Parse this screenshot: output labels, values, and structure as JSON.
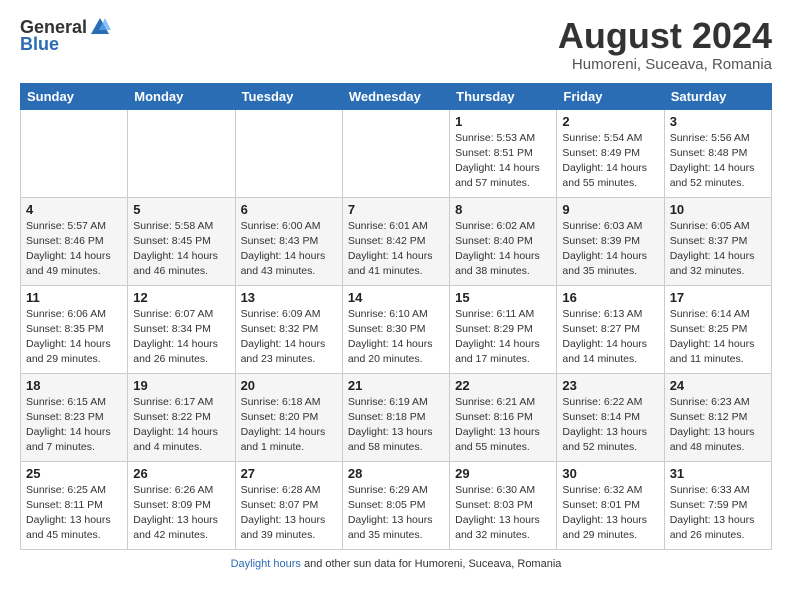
{
  "header": {
    "logo_general": "General",
    "logo_blue": "Blue",
    "month_title": "August 2024",
    "subtitle": "Humoreni, Suceava, Romania"
  },
  "weekdays": [
    "Sunday",
    "Monday",
    "Tuesday",
    "Wednesday",
    "Thursday",
    "Friday",
    "Saturday"
  ],
  "weeks": [
    [
      {
        "day": "",
        "info": ""
      },
      {
        "day": "",
        "info": ""
      },
      {
        "day": "",
        "info": ""
      },
      {
        "day": "",
        "info": ""
      },
      {
        "day": "1",
        "info": "Sunrise: 5:53 AM\nSunset: 8:51 PM\nDaylight: 14 hours and 57 minutes."
      },
      {
        "day": "2",
        "info": "Sunrise: 5:54 AM\nSunset: 8:49 PM\nDaylight: 14 hours and 55 minutes."
      },
      {
        "day": "3",
        "info": "Sunrise: 5:56 AM\nSunset: 8:48 PM\nDaylight: 14 hours and 52 minutes."
      }
    ],
    [
      {
        "day": "4",
        "info": "Sunrise: 5:57 AM\nSunset: 8:46 PM\nDaylight: 14 hours and 49 minutes."
      },
      {
        "day": "5",
        "info": "Sunrise: 5:58 AM\nSunset: 8:45 PM\nDaylight: 14 hours and 46 minutes."
      },
      {
        "day": "6",
        "info": "Sunrise: 6:00 AM\nSunset: 8:43 PM\nDaylight: 14 hours and 43 minutes."
      },
      {
        "day": "7",
        "info": "Sunrise: 6:01 AM\nSunset: 8:42 PM\nDaylight: 14 hours and 41 minutes."
      },
      {
        "day": "8",
        "info": "Sunrise: 6:02 AM\nSunset: 8:40 PM\nDaylight: 14 hours and 38 minutes."
      },
      {
        "day": "9",
        "info": "Sunrise: 6:03 AM\nSunset: 8:39 PM\nDaylight: 14 hours and 35 minutes."
      },
      {
        "day": "10",
        "info": "Sunrise: 6:05 AM\nSunset: 8:37 PM\nDaylight: 14 hours and 32 minutes."
      }
    ],
    [
      {
        "day": "11",
        "info": "Sunrise: 6:06 AM\nSunset: 8:35 PM\nDaylight: 14 hours and 29 minutes."
      },
      {
        "day": "12",
        "info": "Sunrise: 6:07 AM\nSunset: 8:34 PM\nDaylight: 14 hours and 26 minutes."
      },
      {
        "day": "13",
        "info": "Sunrise: 6:09 AM\nSunset: 8:32 PM\nDaylight: 14 hours and 23 minutes."
      },
      {
        "day": "14",
        "info": "Sunrise: 6:10 AM\nSunset: 8:30 PM\nDaylight: 14 hours and 20 minutes."
      },
      {
        "day": "15",
        "info": "Sunrise: 6:11 AM\nSunset: 8:29 PM\nDaylight: 14 hours and 17 minutes."
      },
      {
        "day": "16",
        "info": "Sunrise: 6:13 AM\nSunset: 8:27 PM\nDaylight: 14 hours and 14 minutes."
      },
      {
        "day": "17",
        "info": "Sunrise: 6:14 AM\nSunset: 8:25 PM\nDaylight: 14 hours and 11 minutes."
      }
    ],
    [
      {
        "day": "18",
        "info": "Sunrise: 6:15 AM\nSunset: 8:23 PM\nDaylight: 14 hours and 7 minutes."
      },
      {
        "day": "19",
        "info": "Sunrise: 6:17 AM\nSunset: 8:22 PM\nDaylight: 14 hours and 4 minutes."
      },
      {
        "day": "20",
        "info": "Sunrise: 6:18 AM\nSunset: 8:20 PM\nDaylight: 14 hours and 1 minute."
      },
      {
        "day": "21",
        "info": "Sunrise: 6:19 AM\nSunset: 8:18 PM\nDaylight: 13 hours and 58 minutes."
      },
      {
        "day": "22",
        "info": "Sunrise: 6:21 AM\nSunset: 8:16 PM\nDaylight: 13 hours and 55 minutes."
      },
      {
        "day": "23",
        "info": "Sunrise: 6:22 AM\nSunset: 8:14 PM\nDaylight: 13 hours and 52 minutes."
      },
      {
        "day": "24",
        "info": "Sunrise: 6:23 AM\nSunset: 8:12 PM\nDaylight: 13 hours and 48 minutes."
      }
    ],
    [
      {
        "day": "25",
        "info": "Sunrise: 6:25 AM\nSunset: 8:11 PM\nDaylight: 13 hours and 45 minutes."
      },
      {
        "day": "26",
        "info": "Sunrise: 6:26 AM\nSunset: 8:09 PM\nDaylight: 13 hours and 42 minutes."
      },
      {
        "day": "27",
        "info": "Sunrise: 6:28 AM\nSunset: 8:07 PM\nDaylight: 13 hours and 39 minutes."
      },
      {
        "day": "28",
        "info": "Sunrise: 6:29 AM\nSunset: 8:05 PM\nDaylight: 13 hours and 35 minutes."
      },
      {
        "day": "29",
        "info": "Sunrise: 6:30 AM\nSunset: 8:03 PM\nDaylight: 13 hours and 32 minutes."
      },
      {
        "day": "30",
        "info": "Sunrise: 6:32 AM\nSunset: 8:01 PM\nDaylight: 13 hours and 29 minutes."
      },
      {
        "day": "31",
        "info": "Sunrise: 6:33 AM\nSunset: 7:59 PM\nDaylight: 13 hours and 26 minutes."
      }
    ]
  ],
  "footer": {
    "label": "Daylight hours",
    "text": "and other sun data for Humoreni, Suceava, Romania"
  }
}
